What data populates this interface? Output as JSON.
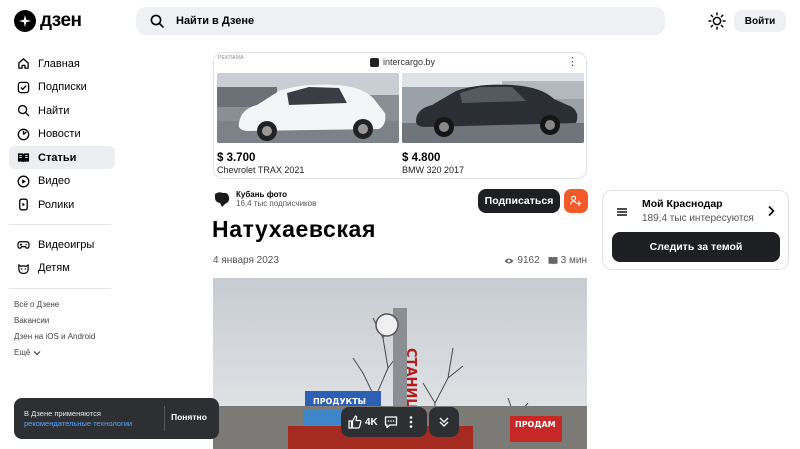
{
  "header": {
    "logo_text": "дзен",
    "search_placeholder": "Найти в Дзене",
    "login_label": "Войти"
  },
  "sidebar": {
    "items": [
      {
        "label": "Главная",
        "icon": "home-icon"
      },
      {
        "label": "Подписки",
        "icon": "subscriptions-icon"
      },
      {
        "label": "Найти",
        "icon": "search-icon"
      },
      {
        "label": "Новости",
        "icon": "news-icon"
      },
      {
        "label": "Статьи",
        "icon": "articles-icon",
        "active": true
      },
      {
        "label": "Видео",
        "icon": "video-icon"
      },
      {
        "label": "Ролики",
        "icon": "shorts-icon"
      }
    ],
    "items2": [
      {
        "label": "Видеоигры",
        "icon": "gamepad-icon"
      },
      {
        "label": "Детям",
        "icon": "kids-icon"
      }
    ],
    "links": [
      "Всё о Дзене",
      "Вакансии",
      "Дзен на iOS и Android",
      "Ещё"
    ]
  },
  "ad": {
    "label": "РЕКЛАМА",
    "source": "intercargo.by",
    "cars": [
      {
        "price": "$ 3.700",
        "name": "Chevrolet TRAX 2021"
      },
      {
        "price": "$ 4.800",
        "name": "BMW 320 2017"
      }
    ]
  },
  "article": {
    "author_name": "Кубань фото",
    "author_subs": "16,4 тыс подписчиков",
    "subscribe_label": "Подписаться",
    "title": "Натухаевская",
    "date": "4 января 2023",
    "views": "9162",
    "read_time": "3 мин"
  },
  "topic": {
    "name": "Мой Краснодар",
    "subs": "189,4 тыс интересуются",
    "follow_label": "Следить за темой"
  },
  "cookie": {
    "text": "В Дзене применяются",
    "link": "рекомендательные технологии",
    "ok_label": "Понятно"
  },
  "actions": {
    "likes": "4K"
  },
  "colors": {
    "accent_orange": "#f25a2a",
    "dark_button": "#1e1f22",
    "search_bg": "#eef0f3"
  }
}
